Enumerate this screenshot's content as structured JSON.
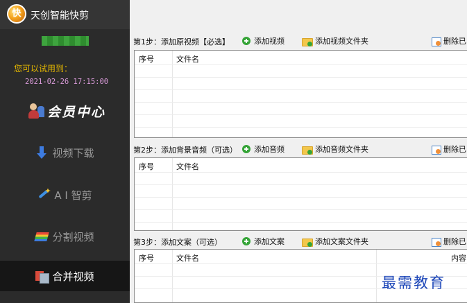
{
  "app": {
    "title": "天创智能快剪",
    "logo_glyph": "快"
  },
  "sidebar": {
    "trial_label": "您可以试用到：",
    "trial_until": "2021-02-26 17:15:00",
    "member_center": "会员中心",
    "nav": [
      {
        "label": "视频下载",
        "icon": "download-arrow-icon",
        "active": false
      },
      {
        "label": "A I 智剪",
        "icon": "ai-wand-icon",
        "active": false
      },
      {
        "label": "分割视频",
        "icon": "split-video-icon",
        "active": false
      },
      {
        "label": "合并视频",
        "icon": "merge-video-icon",
        "active": true
      }
    ]
  },
  "steps": [
    {
      "label": "第1步：添加原视频【必选】",
      "add_label": "添加视频",
      "add_folder_label": "添加视频文件夹",
      "delete_label": "删除已",
      "columns": [
        "序号",
        "文件名"
      ]
    },
    {
      "label": "第2步：添加背景音频（可选）",
      "add_label": "添加音频",
      "add_folder_label": "添加音频文件夹",
      "delete_label": "删除已",
      "columns": [
        "序号",
        "文件名"
      ]
    },
    {
      "label": "第3步：添加文案（可选）",
      "add_label": "添加文案",
      "add_folder_label": "添加文案文件夹",
      "delete_label": "删除已",
      "columns": [
        "序号",
        "文件名",
        "内容"
      ]
    }
  ],
  "watermark": "最需教育",
  "colors": {
    "sidebar_bg": "#2b2b2b",
    "trial_label": "#e6b800",
    "trial_time": "#d89ad8",
    "add_icon": "#35a437",
    "watermark": "#1c46b8"
  }
}
